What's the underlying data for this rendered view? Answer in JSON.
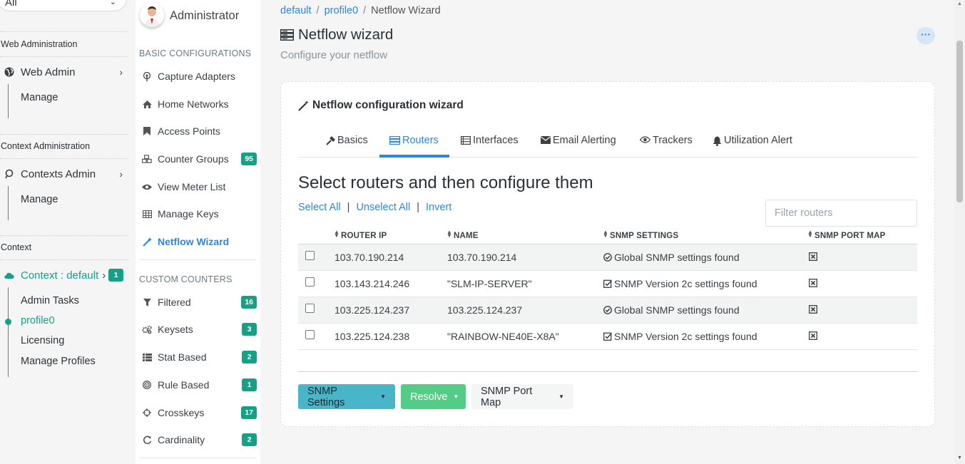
{
  "left_sidebar": {
    "context_select_value": "All",
    "web_admin_section": "Web Administration",
    "web_admin_label": "Web Admin",
    "web_admin_manage": "Manage",
    "context_admin_section": "Context Administration",
    "contexts_admin_label": "Contexts Admin",
    "contexts_admin_manage": "Manage",
    "context_section": "Context",
    "context_default_label": "Context : default",
    "context_default_badge": "1",
    "context_subitems": [
      "Admin Tasks",
      "profile0",
      "Licensing",
      "Manage Profiles"
    ],
    "active_subitem": "profile0"
  },
  "menu_sidebar": {
    "admin_name": "Administrator",
    "basic_heading": "BASIC CONFIGURATIONS",
    "basic_items": [
      {
        "label": "Capture Adapters",
        "icon": "broadcast-icon",
        "badge": ""
      },
      {
        "label": "Home Networks",
        "icon": "home-icon",
        "badge": ""
      },
      {
        "label": "Access Points",
        "icon": "bookmark-icon",
        "badge": ""
      },
      {
        "label": "Counter Groups",
        "icon": "cubes-icon",
        "badge": "95"
      },
      {
        "label": "View Meter List",
        "icon": "eye-icon",
        "badge": ""
      },
      {
        "label": "Manage Keys",
        "icon": "table-icon",
        "badge": ""
      },
      {
        "label": "Netflow Wizard",
        "icon": "magic-wand-icon",
        "badge": ""
      }
    ],
    "active_item": "Netflow Wizard",
    "custom_heading": "CUSTOM COUNTERS",
    "custom_items": [
      {
        "label": "Filtered",
        "icon": "filter-icon",
        "badge": "16"
      },
      {
        "label": "Keysets",
        "icon": "cogs-icon",
        "badge": "3"
      },
      {
        "label": "Stat Based",
        "icon": "list-icon",
        "badge": "2"
      },
      {
        "label": "Rule Based",
        "icon": "target-icon",
        "badge": "1"
      },
      {
        "label": "Crosskeys",
        "icon": "crosshair-icon",
        "badge": "17"
      },
      {
        "label": "Cardinality",
        "icon": "refresh-icon",
        "badge": "2"
      }
    ],
    "accent_color": "#16a085",
    "active_color": "#2e86de"
  },
  "main": {
    "breadcrumb": [
      "default",
      "profile0",
      "Netflow Wizard"
    ],
    "title": "Netflow wizard",
    "subtitle": "Configure your netflow",
    "card_title": "Netflow configuration wizard",
    "tabs": [
      {
        "label": "Basics",
        "icon": "hammer-icon"
      },
      {
        "label": "Routers",
        "icon": "server-icon"
      },
      {
        "label": "Interfaces",
        "icon": "list-icon"
      },
      {
        "label": "Email Alerting",
        "icon": "envelope-icon"
      },
      {
        "label": "Trackers",
        "icon": "eye-icon"
      },
      {
        "label": "Utilization Alert",
        "icon": "bell-icon"
      }
    ],
    "active_tab": "Routers",
    "section_heading": "Select routers and then configure them",
    "select_all": "Select All",
    "unselect_all": "Unselect All",
    "invert": "Invert",
    "filter_placeholder": "Filter routers",
    "table": {
      "columns": [
        "ROUTER IP",
        "NAME",
        "SNMP SETTINGS",
        "SNMP PORT MAP"
      ],
      "rows": [
        {
          "ip": "103.70.190.214",
          "name": "103.70.190.214",
          "snmp": "Global SNMP settings found",
          "snmp_icon": "check-circle-icon",
          "checked": false
        },
        {
          "ip": "103.143.214.246",
          "name": "\"SLM-IP-SERVER\"",
          "snmp": "SNMP Version 2c settings found",
          "snmp_icon": "check-square-icon",
          "checked": false
        },
        {
          "ip": "103.225.124.237",
          "name": "103.225.124.237",
          "snmp": "Global SNMP settings found",
          "snmp_icon": "check-circle-icon",
          "checked": false
        },
        {
          "ip": "103.225.124.238",
          "name": "\"RAINBOW-NE40E-X8A\"",
          "snmp": "SNMP Version 2c settings found",
          "snmp_icon": "check-square-icon",
          "checked": false
        }
      ]
    },
    "buttons": {
      "snmp_settings": "SNMP Settings",
      "resolve": "Resolve",
      "snmp_port_map": "SNMP Port Map"
    }
  }
}
